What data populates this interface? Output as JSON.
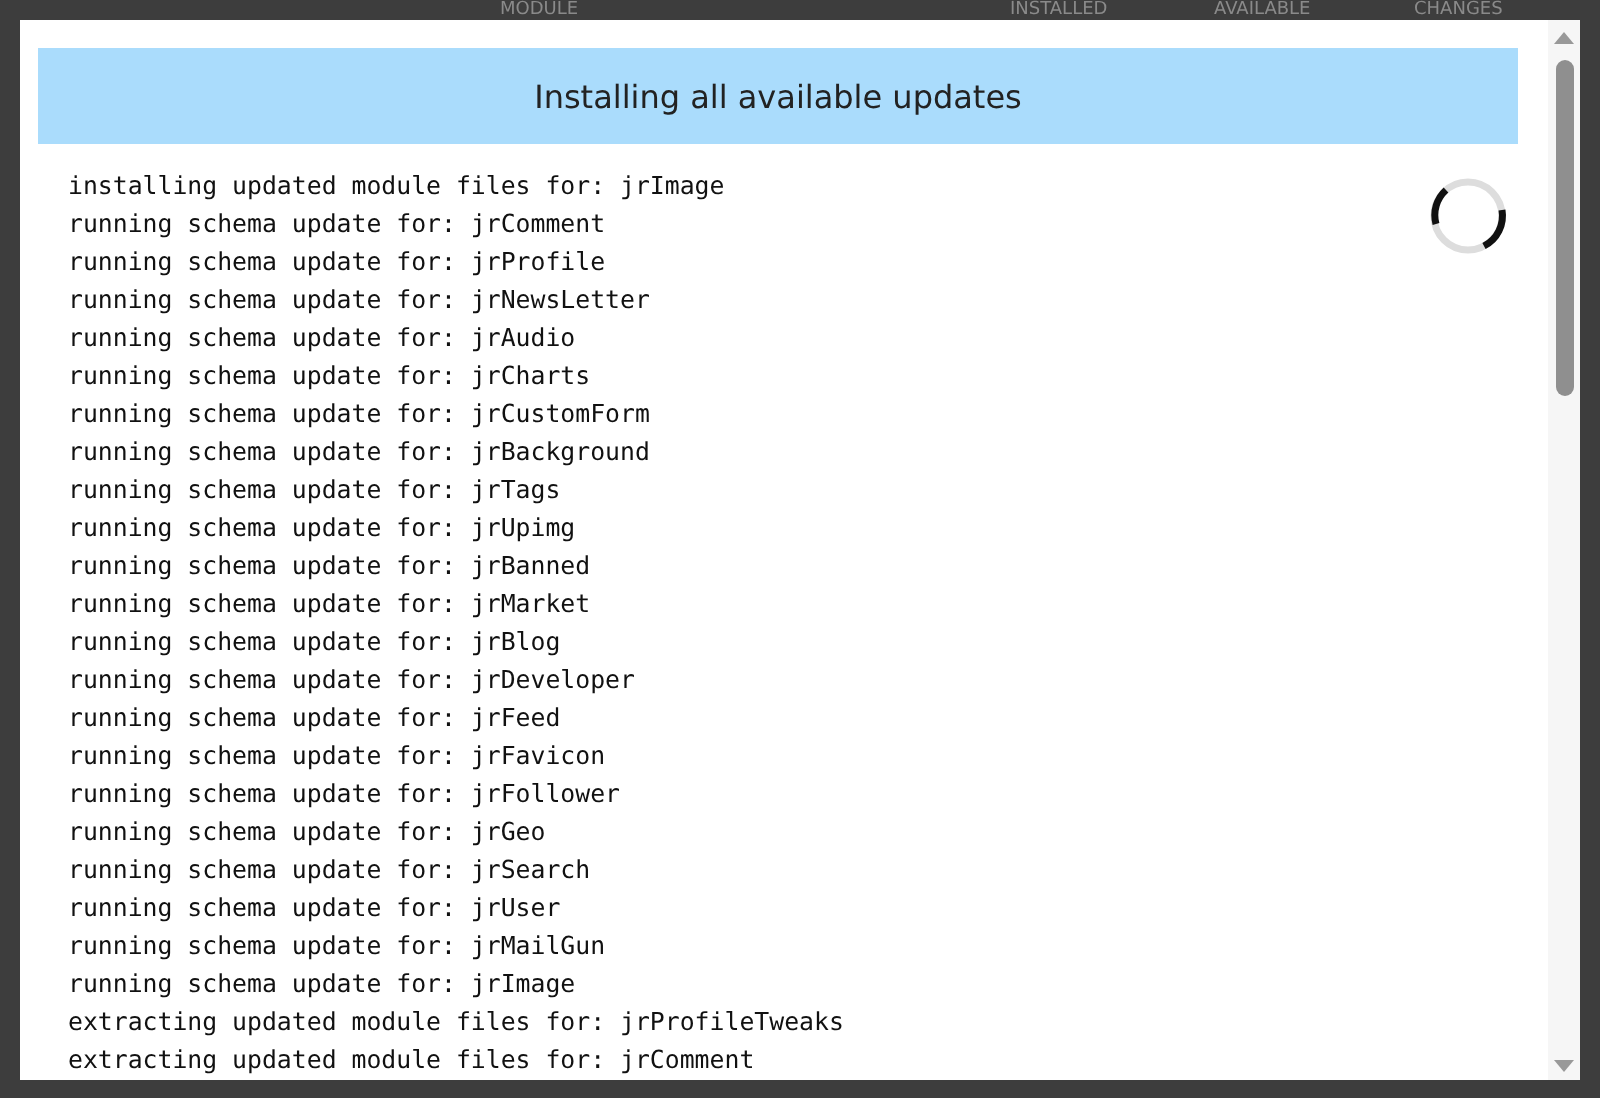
{
  "background_table": {
    "columns": [
      "MODULE",
      "INSTALLED",
      "AVAILABLE",
      "CHANGES"
    ]
  },
  "dialog": {
    "title": "Installing all available updates",
    "log": [
      "installing updated module files for: jrImage",
      "running schema update for: jrComment",
      "running schema update for: jrProfile",
      "running schema update for: jrNewsLetter",
      "running schema update for: jrAudio",
      "running schema update for: jrCharts",
      "running schema update for: jrCustomForm",
      "running schema update for: jrBackground",
      "running schema update for: jrTags",
      "running schema update for: jrUpimg",
      "running schema update for: jrBanned",
      "running schema update for: jrMarket",
      "running schema update for: jrBlog",
      "running schema update for: jrDeveloper",
      "running schema update for: jrFeed",
      "running schema update for: jrFavicon",
      "running schema update for: jrFollower",
      "running schema update for: jrGeo",
      "running schema update for: jrSearch",
      "running schema update for: jrUser",
      "running schema update for: jrMailGun",
      "running schema update for: jrImage",
      "extracting updated module files for: jrProfileTweaks",
      "extracting updated module files for: jrComment"
    ]
  }
}
